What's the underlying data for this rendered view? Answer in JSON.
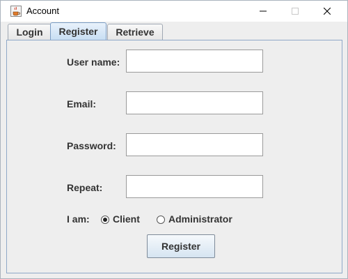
{
  "window": {
    "title": "Account"
  },
  "tabs": [
    {
      "label": "Login",
      "selected": false
    },
    {
      "label": "Register",
      "selected": true
    },
    {
      "label": "Retrieve",
      "selected": false
    }
  ],
  "form": {
    "username_label": "User name:",
    "username_value": "",
    "email_label": "Email:",
    "email_value": "",
    "password_label": "Password:",
    "password_value": "",
    "repeat_label": "Repeat:",
    "repeat_value": "",
    "role_label": "I am:",
    "role_options": [
      {
        "label": "Client",
        "checked": true
      },
      {
        "label": "Administrator",
        "checked": false
      }
    ],
    "submit_label": "Register"
  },
  "icons": {
    "app": "java-cup-icon",
    "minimize": "minimize-icon",
    "maximize": "maximize-icon",
    "close": "close-icon"
  },
  "colors": {
    "selected_tab": "#c6ddf3",
    "panel_border": "#8fa8c8",
    "background": "#eeeeee"
  }
}
